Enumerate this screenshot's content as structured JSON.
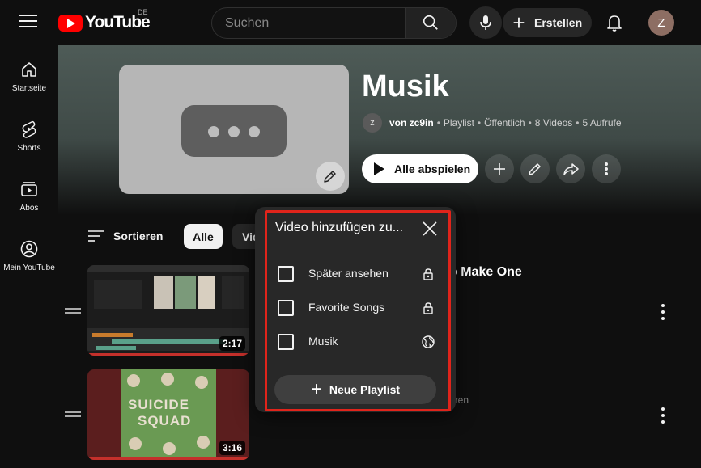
{
  "header": {
    "logo_text": "YouTube",
    "country_code": "DE",
    "search_placeholder": "Suchen",
    "create_label": "Erstellen",
    "avatar_initial": "Z"
  },
  "sidebar": {
    "items": [
      {
        "label": "Startseite",
        "icon": "home-icon"
      },
      {
        "label": "Shorts",
        "icon": "shorts-icon"
      },
      {
        "label": "Abos",
        "icon": "subscriptions-icon"
      },
      {
        "label": "Mein YouTube",
        "icon": "account-icon"
      }
    ]
  },
  "playlist": {
    "title": "Musik",
    "owner_initial": "z",
    "owner": "von zc9in",
    "type": "Playlist",
    "visibility": "Öffentlich",
    "video_count": "8 Videos",
    "views": "5 Aufrufe",
    "separator": "•",
    "play_all_label": "Alle abspielen"
  },
  "filters": {
    "sort_label": "Sortieren",
    "chips": [
      "Alle",
      "Videos"
    ]
  },
  "videos": [
    {
      "duration": "2:17",
      "title_visible": "o Make One"
    },
    {
      "duration": "3:16",
      "poster_text_1": "SUICIDE",
      "poster_text_2": "SQUAD",
      "meta_visible": "hren"
    }
  ],
  "dialog": {
    "title": "Video hinzufügen zu...",
    "playlists": [
      {
        "name": "Später ansehen",
        "privacy": "lock-icon",
        "checked": false
      },
      {
        "name": "Favorite Songs",
        "privacy": "lock-icon",
        "checked": false
      },
      {
        "name": "Musik",
        "privacy": "globe-icon",
        "checked": false
      }
    ],
    "new_playlist_label": "Neue Playlist"
  },
  "colors": {
    "brand_red": "#ff0000",
    "highlight_red": "#e0241b",
    "background": "#0f0f0f",
    "dialog_bg": "#282828"
  }
}
